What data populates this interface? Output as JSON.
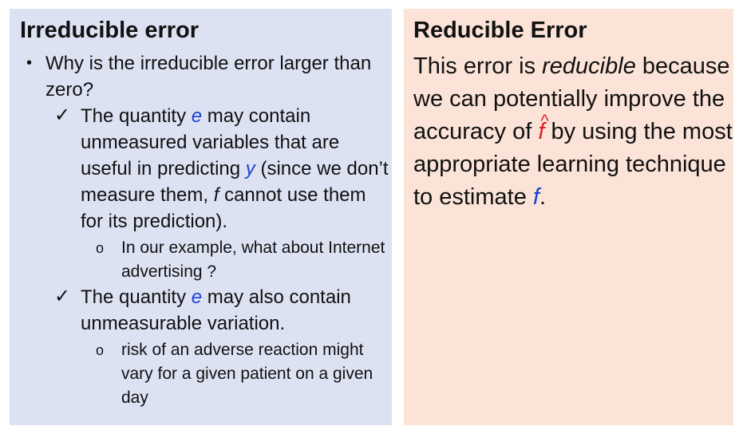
{
  "left": {
    "title": "Irreducible error",
    "bullet_glyph": "•",
    "question": "Why is the irreducible error larger than zero?",
    "check_glyph": "✓",
    "sub_glyph": "o",
    "reason1": {
      "before_e": "The quantity ",
      "e": "e",
      "after_e": " may contain unmeasured variables that are useful in predicting ",
      "y": "y",
      "mid": "  (since we don’t measure them, ",
      "f": "f",
      "end": " cannot use them for its prediction)."
    },
    "example1": "In our example, what about Internet advertising ?",
    "reason2": {
      "before_e": "The quantity ",
      "e": "e",
      "after_e": " may also contain unmeasurable variation."
    },
    "example2": "risk of an adverse reaction might vary for a given patient on a given day"
  },
  "right": {
    "title": "Reducible Error",
    "p1": "This error is ",
    "reducible": "reducible",
    "p2": " because we can potentially improve the accuracy of ",
    "fhat_hat": "^",
    "fhat_f": "f",
    "p3": " by using the most appropriate learning technique to estimate ",
    "f": "f",
    "p4": "."
  },
  "colors": {
    "left_bg": "#dde2f3",
    "right_bg": "#fbe3d7",
    "variable": "#1a3fd6",
    "fhat": "#e01f1f"
  }
}
